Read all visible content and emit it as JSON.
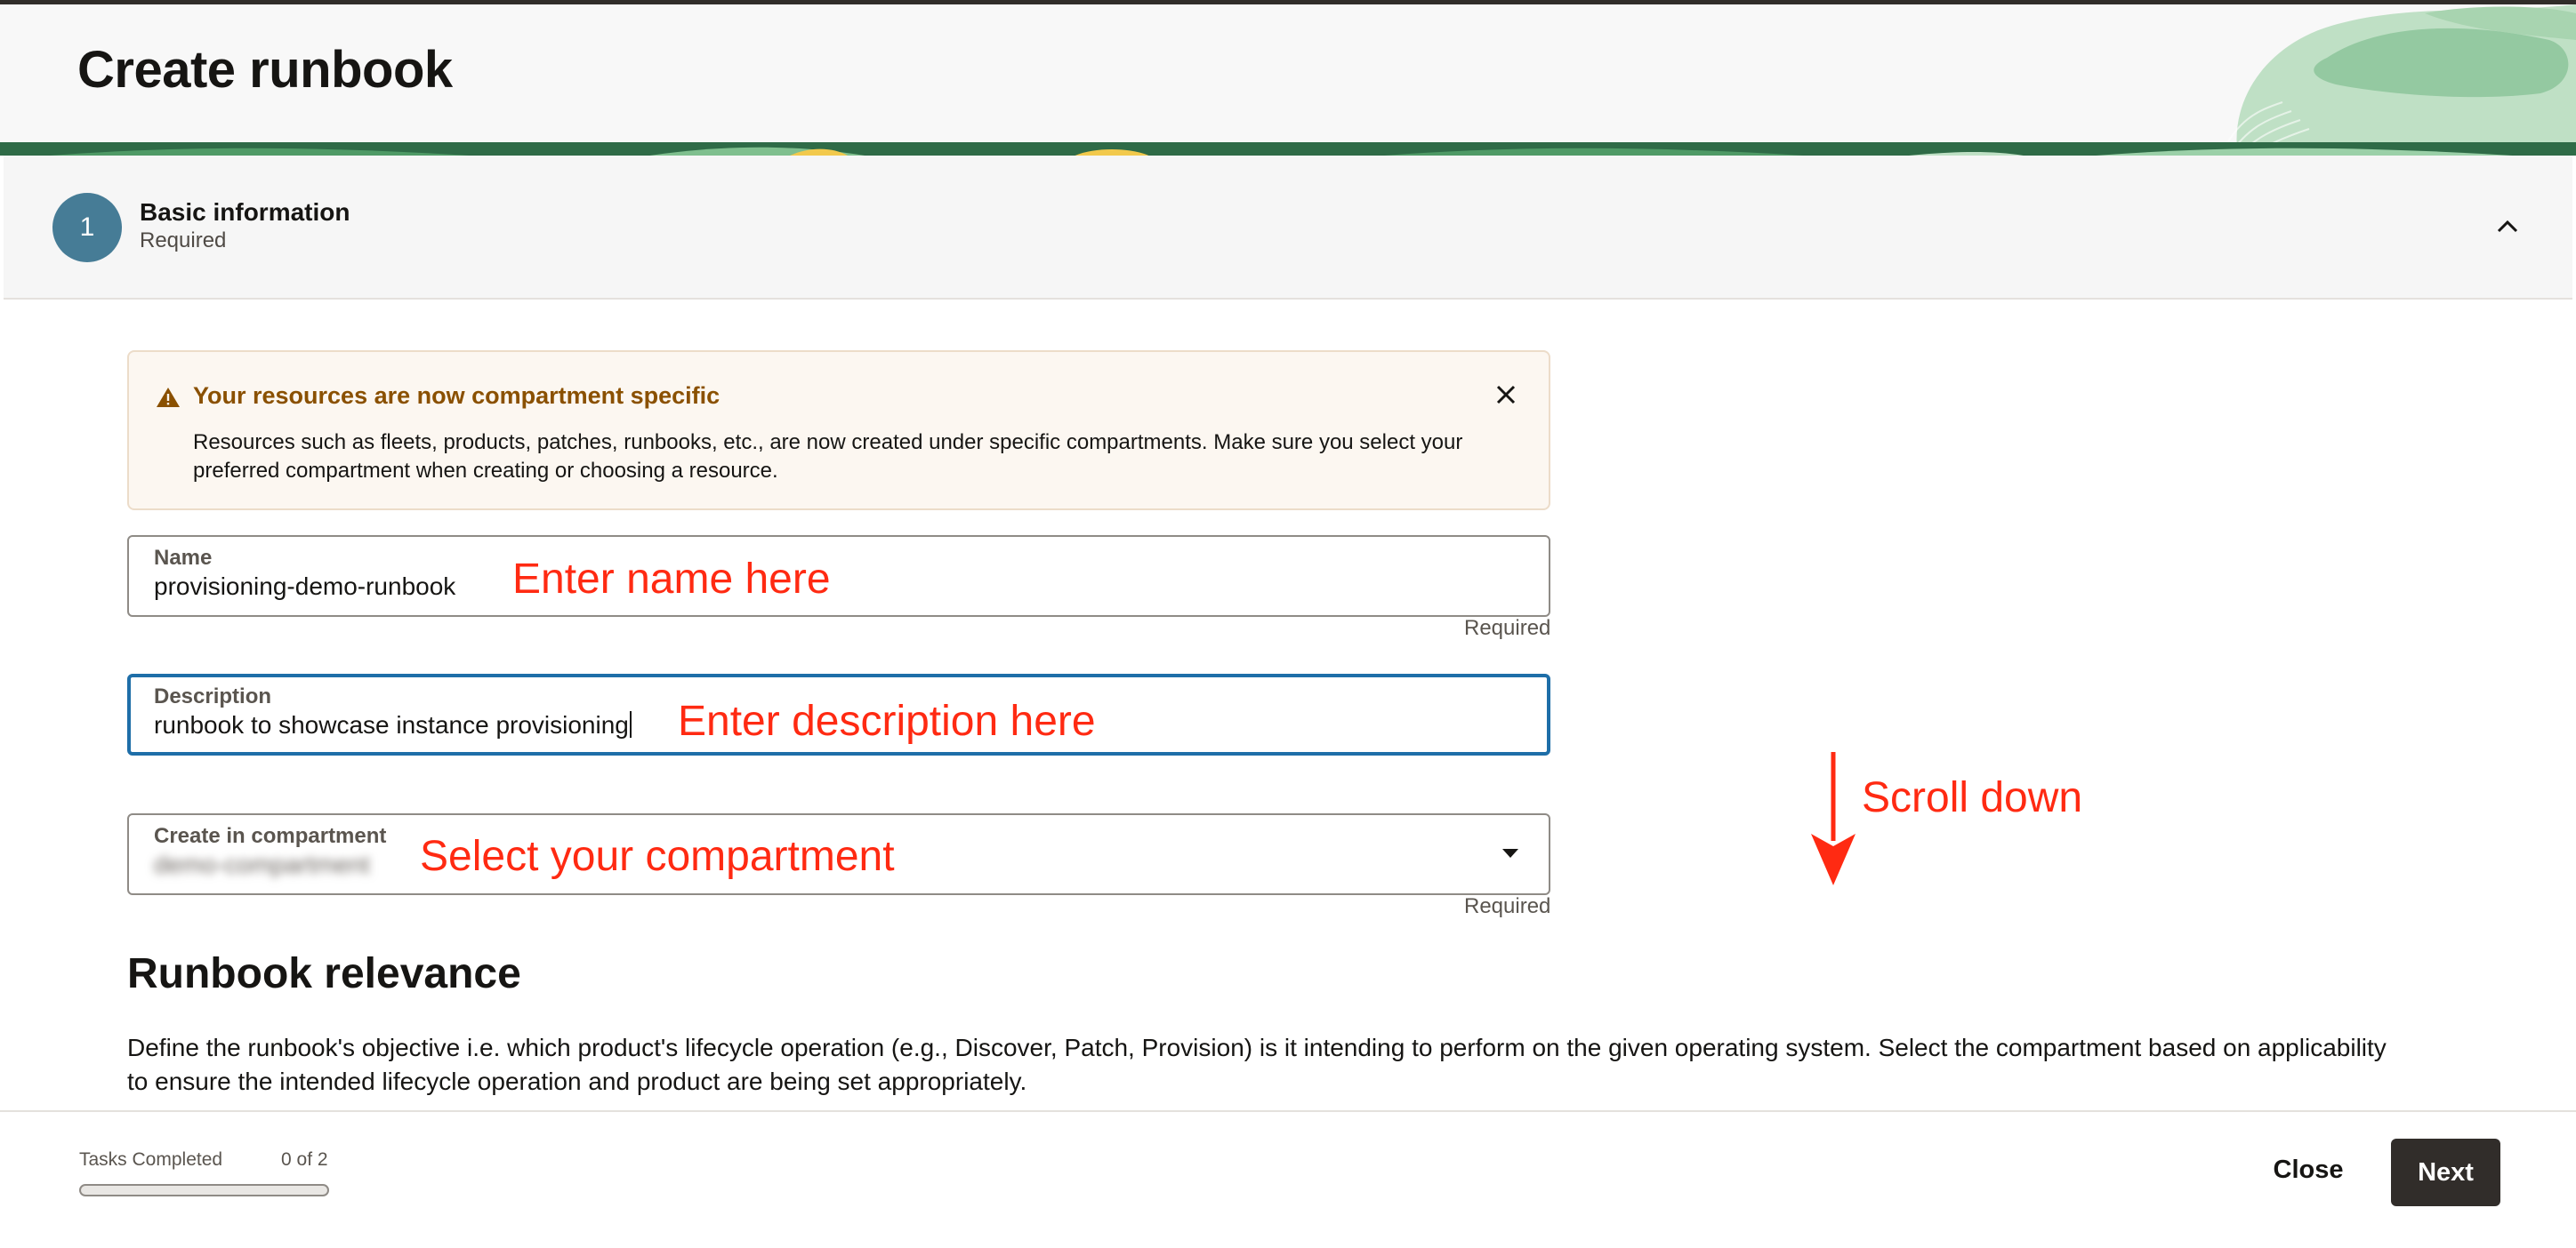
{
  "header": {
    "title": "Create runbook"
  },
  "step": {
    "number": "1",
    "title": "Basic information",
    "subtitle": "Required"
  },
  "alert": {
    "title": "Your resources are now compartment specific",
    "body": "Resources such as fleets, products, patches, runbooks, etc., are now created under specific compartments. Make sure you select your preferred compartment when creating or choosing a resource."
  },
  "form": {
    "name": {
      "label": "Name",
      "value": "provisioning-demo-runbook",
      "required": "Required"
    },
    "description": {
      "label": "Description",
      "value": "runbook to showcase instance provisioning"
    },
    "compartment": {
      "label": "Create in compartment",
      "value": "demo-compartment",
      "required": "Required"
    }
  },
  "annotations": {
    "name": "Enter name here",
    "description": "Enter description here",
    "compartment": "Select your compartment",
    "scroll": "Scroll down"
  },
  "section": {
    "title": "Runbook relevance",
    "body": "Define the runbook's objective i.e. which product's lifecycle operation (e.g., Discover, Patch, Provision) is it intending to perform on the given operating system. Select the compartment based on applicability to ensure the intended lifecycle operation and product are being set appropriately."
  },
  "footer": {
    "tasks_label": "Tasks Completed",
    "tasks_count": "0 of 2",
    "progress_fraction": 0,
    "close_label": "Close",
    "next_label": "Next"
  },
  "colors": {
    "step_circle": "#467c96",
    "annotation": "#ff2a12",
    "alert_title": "#8a5000",
    "focus_border": "#1e6ea8",
    "primary_button": "#312d2a"
  }
}
